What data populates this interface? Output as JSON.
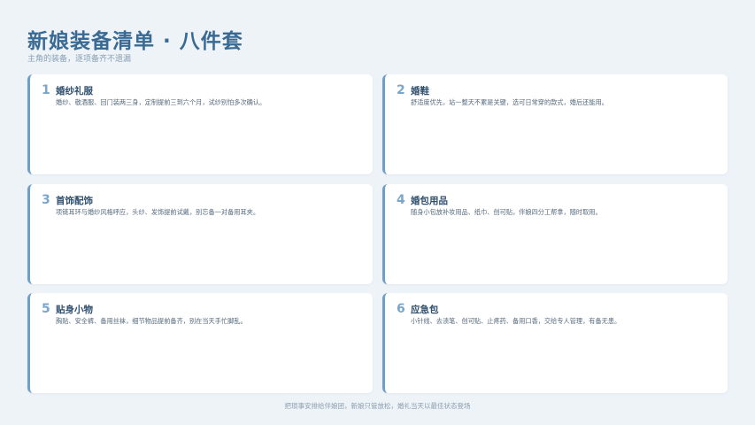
{
  "header": {
    "title": "新娘装备清单 · 八件套",
    "subtitle": "主角的装备，逐项备齐不遗漏"
  },
  "items": [
    {
      "num": "1",
      "name": "婚纱礼服",
      "desc": "婚纱、敬酒服、回门装两三身，定制提前三到六个月，试纱别怕多次确认。"
    },
    {
      "num": "2",
      "name": "婚鞋",
      "desc": "舒适度优先，站一整天不累是关键，选可日常穿的款式，婚后还能用。"
    },
    {
      "num": "3",
      "name": "首饰配饰",
      "desc": "项链耳环与婚纱风格呼应，头纱、发饰提前试戴，别忘备一对备用耳夹。"
    },
    {
      "num": "4",
      "name": "婚包用品",
      "desc": "随身小包放补妆用品、纸巾、创可贴，伴娘四分工帮拿，随时取用。"
    },
    {
      "num": "5",
      "name": "贴身小物",
      "desc": "胸贴、安全裤、备用丝袜，细节物品提前备齐，别在当天手忙脚乱。"
    },
    {
      "num": "6",
      "name": "应急包",
      "desc": "小针线、去渍笔、创可贴、止疼药、备用口香，交给专人管理，有备无患。"
    }
  ],
  "footer": "把琐事安排给伴娘团，新娘只管放松，婚礼当天以最佳状态登场"
}
